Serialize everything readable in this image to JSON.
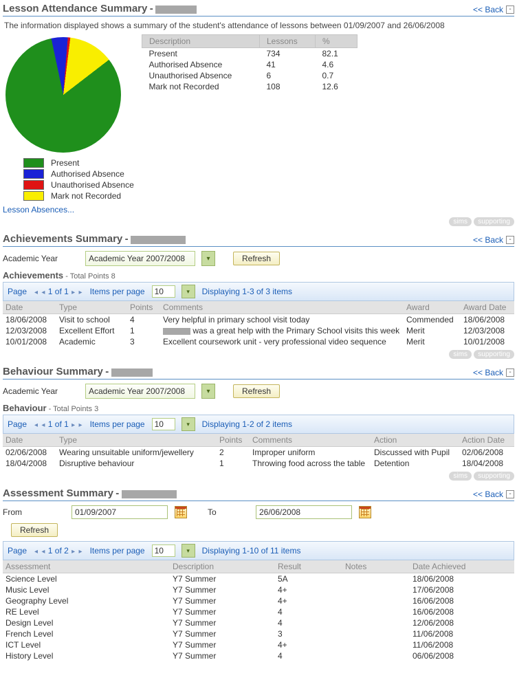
{
  "common": {
    "back": "<< Back",
    "collapse": "-",
    "refresh": "Refresh",
    "academic_year_label": "Academic Year",
    "academic_year_value": "Academic Year 2007/2008",
    "from_label": "From",
    "to_label": "To",
    "pager": {
      "page_label": "Page",
      "ipp_label": "Items per page",
      "ipp_value": "10"
    }
  },
  "attendance": {
    "title": "Lesson Attendance Summary",
    "info": "The information displayed shows a summary of the student's attendance of lessons between 01/09/2007 and 26/06/2008",
    "table_headers": {
      "desc": "Description",
      "lessons": "Lessons",
      "pct": "%"
    },
    "rows": [
      {
        "desc": "Present",
        "lessons": "734",
        "pct": "82.1",
        "color": "#1f8f1c"
      },
      {
        "desc": "Authorised Absence",
        "lessons": "41",
        "pct": "4.6",
        "color": "#1a22d6"
      },
      {
        "desc": "Unauthorised Absence",
        "lessons": "6",
        "pct": "0.7",
        "color": "#e01313"
      },
      {
        "desc": "Mark not Recorded",
        "lessons": "108",
        "pct": "12.6",
        "color": "#f9ee00"
      }
    ],
    "link": "Lesson Absences..."
  },
  "achievements": {
    "title": "Achievements Summary",
    "subtitle": "Achievements",
    "sub_note": " - Total Points 8",
    "pager_info": {
      "of": "1 of 1",
      "display": "Displaying 1-3 of 3 items"
    },
    "headers": {
      "date": "Date",
      "type": "Type",
      "points": "Points",
      "comments": "Comments",
      "award": "Award",
      "award_date": "Award Date"
    },
    "rows": [
      {
        "date": "18/06/2008",
        "type": "Visit to school",
        "points": "4",
        "comments": "Very helpful in primary school visit today",
        "award": "Commended",
        "award_date": "18/06/2008"
      },
      {
        "date": "12/03/2008",
        "type": "Excellent Effort",
        "points": "1",
        "comments": "was a great help with the Primary School visits this week",
        "award": "Merit",
        "award_date": "12/03/2008",
        "redact_prefix": true
      },
      {
        "date": "10/01/2008",
        "type": "Academic",
        "points": "3",
        "comments": "Excellent coursework unit - very professional video sequence",
        "award": "Merit",
        "award_date": "10/01/2008"
      }
    ]
  },
  "behaviour": {
    "title": "Behaviour Summary",
    "subtitle": "Behaviour",
    "sub_note": " - Total Points 3",
    "pager_info": {
      "of": "1 of 1",
      "display": "Displaying 1-2 of 2 items"
    },
    "headers": {
      "date": "Date",
      "type": "Type",
      "points": "Points",
      "comments": "Comments",
      "action": "Action",
      "action_date": "Action Date"
    },
    "rows": [
      {
        "date": "02/06/2008",
        "type": "Wearing unsuitable uniform/jewellery",
        "points": "2",
        "comments": "Improper uniform",
        "action": "Discussed with Pupil",
        "action_date": "02/06/2008"
      },
      {
        "date": "18/04/2008",
        "type": "Disruptive behaviour",
        "points": "1",
        "comments": "Throwing food across the table",
        "action": "Detention",
        "action_date": "18/04/2008"
      }
    ]
  },
  "assessment": {
    "title": "Assessment Summary",
    "from": "01/09/2007",
    "to": "26/06/2008",
    "pager_info": {
      "of": "1 of 2",
      "display": "Displaying 1-10 of 11 items"
    },
    "headers": {
      "assessment": "Assessment",
      "description": "Description",
      "result": "Result",
      "notes": "Notes",
      "date": "Date Achieved"
    },
    "rows": [
      {
        "assessment": "Science Level",
        "description": "Y7 Summer",
        "result": "5A",
        "notes": "",
        "date": "18/06/2008"
      },
      {
        "assessment": "Music Level",
        "description": "Y7 Summer",
        "result": "4+",
        "notes": "",
        "date": "17/06/2008"
      },
      {
        "assessment": "Geography Level",
        "description": "Y7 Summer",
        "result": "4+",
        "notes": "",
        "date": "16/06/2008"
      },
      {
        "assessment": "RE Level",
        "description": "Y7 Summer",
        "result": "4",
        "notes": "",
        "date": "16/06/2008"
      },
      {
        "assessment": "Design Level",
        "description": "Y7 Summer",
        "result": "4",
        "notes": "",
        "date": "12/06/2008"
      },
      {
        "assessment": "French Level",
        "description": "Y7 Summer",
        "result": "3",
        "notes": "",
        "date": "11/06/2008"
      },
      {
        "assessment": "ICT Level",
        "description": "Y7 Summer",
        "result": "4+",
        "notes": "",
        "date": "11/06/2008"
      },
      {
        "assessment": "History Level",
        "description": "Y7 Summer",
        "result": "4",
        "notes": "",
        "date": "06/06/2008"
      }
    ]
  },
  "chart_data": {
    "type": "pie",
    "title": "Lesson Attendance",
    "series": [
      {
        "name": "Present",
        "value": 734,
        "pct": 82.1,
        "color": "#1f8f1c"
      },
      {
        "name": "Authorised Absence",
        "value": 41,
        "pct": 4.6,
        "color": "#1a22d6"
      },
      {
        "name": "Unauthorised Absence",
        "value": 6,
        "pct": 0.7,
        "color": "#e01313"
      },
      {
        "name": "Mark not Recorded",
        "value": 108,
        "pct": 12.6,
        "color": "#f9ee00"
      }
    ]
  }
}
